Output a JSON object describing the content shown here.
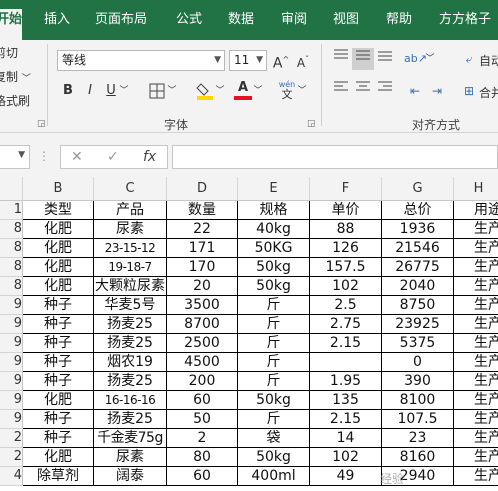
{
  "ribbon": {
    "tabs": [
      "开始",
      "插入",
      "页面布局",
      "公式",
      "数据",
      "审阅",
      "视图",
      "帮助",
      "方方格子"
    ],
    "clipboard": {
      "cut": "剪切",
      "copy": "复制",
      "painter": "格式刷"
    },
    "font": {
      "name": "等线",
      "size": "11",
      "group_label": "字体",
      "phonetic": "wén"
    },
    "alignment": {
      "group_label": "对齐方式",
      "wrap": "自动",
      "merge": "合并"
    }
  },
  "colors": {
    "accent": "#217346",
    "font_color": "#e81123",
    "fill_color": "#ffd800"
  },
  "formula_bar": {
    "fx": "fx",
    "cancel": "✕",
    "enter": "✓"
  },
  "grid": {
    "columns": [
      "B",
      "C",
      "D",
      "E",
      "F",
      "G",
      "H"
    ],
    "headers": [
      "类型",
      "产品",
      "数量",
      "规格",
      "单价",
      "总价",
      "用途"
    ],
    "rownums": [
      "1",
      "8",
      "8",
      "8",
      "8",
      "9",
      "9",
      "9",
      "9",
      "9",
      "9",
      "9",
      "2",
      "2",
      "4",
      "4"
    ],
    "rows": [
      [
        "化肥",
        "尿素",
        "22",
        "40kg",
        "88",
        "1936",
        "生产"
      ],
      [
        "化肥",
        "23-15-12",
        "171",
        "50KG",
        "126",
        "21546",
        "生产"
      ],
      [
        "化肥",
        "19-18-7",
        "170",
        "50kg",
        "157.5",
        "26775",
        "生产"
      ],
      [
        "化肥",
        "大颗粒尿素",
        "20",
        "50kg",
        "102",
        "2040",
        "生产"
      ],
      [
        "种子",
        "华麦5号",
        "3500",
        "斤",
        "2.5",
        "8750",
        "生产"
      ],
      [
        "种子",
        "扬麦25",
        "8700",
        "斤",
        "2.75",
        "23925",
        "生产"
      ],
      [
        "种子",
        "扬麦25",
        "2500",
        "斤",
        "2.15",
        "5375",
        "生产"
      ],
      [
        "种子",
        "烟农19",
        "4500",
        "斤",
        "",
        "0",
        "生产"
      ],
      [
        "种子",
        "扬麦25",
        "200",
        "斤",
        "1.95",
        "390",
        "生产"
      ],
      [
        "化肥",
        "16-16-16",
        "60",
        "50kg",
        "135",
        "8100",
        "生产"
      ],
      [
        "种子",
        "扬麦25",
        "50",
        "斤",
        "2.15",
        "107.5",
        "生产"
      ],
      [
        "种子",
        "千金麦75g",
        "2",
        "袋",
        "14",
        "23",
        "生产"
      ],
      [
        "化肥",
        "尿素",
        "80",
        "50kg",
        "102",
        "8160",
        "生产"
      ],
      [
        "除草剂",
        "阔泰",
        "60",
        "400ml",
        "49",
        "2940",
        "生产"
      ]
    ]
  },
  "watermark": "经验"
}
